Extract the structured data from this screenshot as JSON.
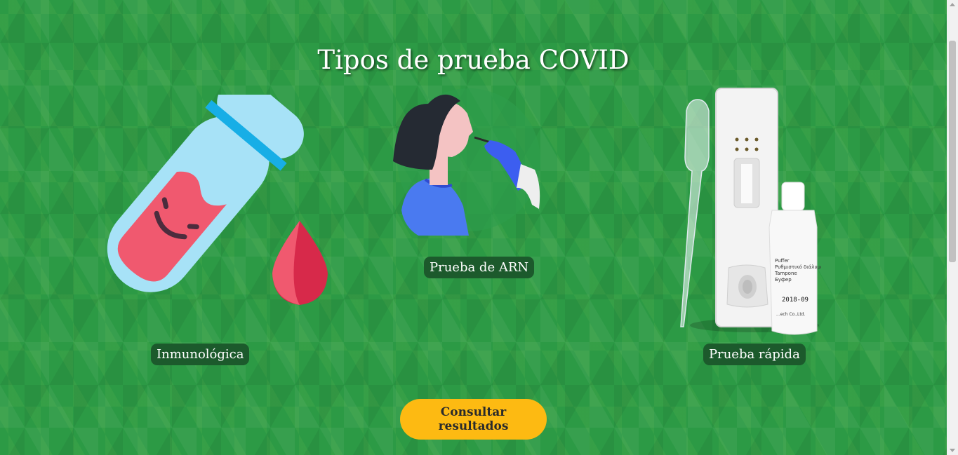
{
  "page": {
    "title": "Tipos de prueba COVID"
  },
  "tests": [
    {
      "label": "Inmunológica",
      "icon": "test-tube-blood-icon"
    },
    {
      "label": "Prueba de ARN",
      "icon": "nasal-swab-icon"
    },
    {
      "label": "Prueba rápida",
      "icon": "rapid-test-kit-icon"
    }
  ],
  "kit_label": [
    "Puffer",
    "Ρυθμιστικό διάλυμα",
    "Tampone",
    "Буфер"
  ],
  "kit_lot": "2018-09",
  "kit_maker": "...ech Co.,Ltd.",
  "cta": {
    "label": "Consultar resultados"
  },
  "colors": {
    "cta": "#fdba12",
    "caption_bg": "#1c5a2c",
    "background": "#2c9a45"
  }
}
